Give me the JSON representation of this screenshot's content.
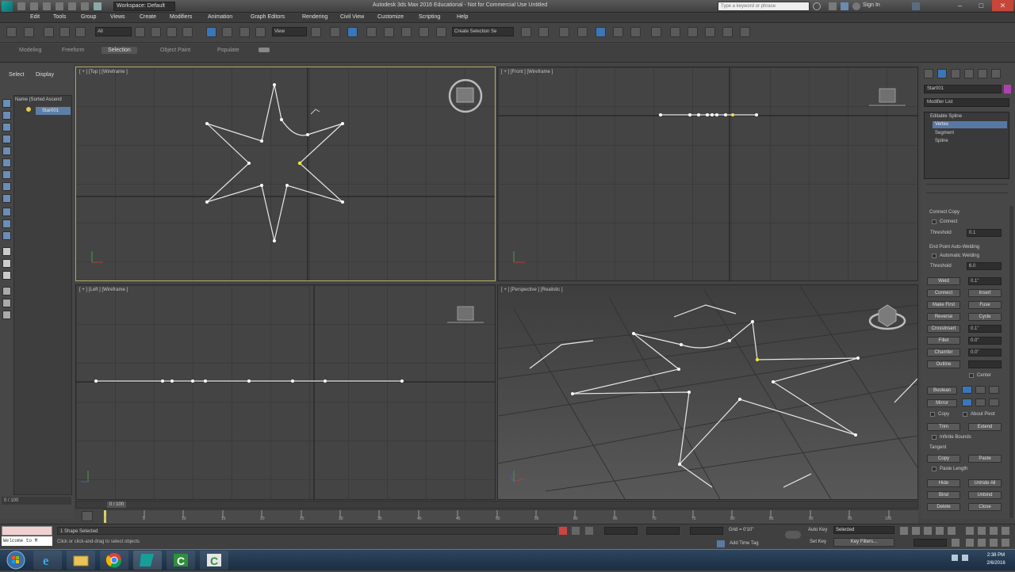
{
  "window": {
    "workspace": "Workspace: Default",
    "title": "Autodesk 3ds Max 2016 Educational - Not for Commercial Use   Untitled",
    "search_placeholder": "Type a keyword or phrase",
    "sign_in": "Sign In",
    "minimize": "–",
    "maximize": "□",
    "close": "✕"
  },
  "menus": [
    "Edit",
    "Tools",
    "Group",
    "Views",
    "Create",
    "Modifiers",
    "Animation",
    "Graph Editors",
    "Rendering",
    "Civil View",
    "Customize",
    "Scripting",
    "Help"
  ],
  "toolbar": {
    "selection_filter": "All",
    "ref_coord": "View",
    "named_selection": "Create Selection Se"
  },
  "ribbon_tabs": [
    "Modeling",
    "Freeform",
    "Selection",
    "Object Paint",
    "Populate"
  ],
  "ribbon_selected": "Selection",
  "scene_explorer": {
    "tab_select": "Select",
    "tab_display": "Display",
    "header": "Name (Sorted Ascend",
    "items": [
      "Star001"
    ],
    "footer": "0 / 100"
  },
  "viewports": {
    "top": "[ + ] [Top ] [Wireframe ]",
    "front": "[ + ] [Front ] [Wireframe ]",
    "left": "[ + ] [Left ] [Wireframe ]",
    "perspective": "[ + ] [Perspective ] [Realistic ]"
  },
  "command_panel": {
    "object_name": "Star001",
    "object_color": "#b23fb0",
    "modifier_list": "Modifier List",
    "stack": [
      "Editable Spline",
      "Vertex",
      "Segment",
      "Spline"
    ],
    "stack_selected": "Vertex",
    "connect_copy": "Connect Copy",
    "connect": "Connect",
    "threshold": "Threshold",
    "threshold_value": "0.1",
    "end_point_welding": "End Point Auto-Welding",
    "automatic_welding": "Automatic Welding",
    "threshold2_value": "6.0",
    "weld": "Weld",
    "weld_value": "0.1\"",
    "connect_btn": "Connect",
    "insert": "Insert",
    "make_first": "Make First",
    "fuse": "Fuse",
    "reverse": "Reverse",
    "cycle": "Cycle",
    "crossinsert": "CrossInsert",
    "crossinsert_value": "0.1\"",
    "fillet": "Fillet",
    "fillet_value": "0.0\"",
    "chamfer": "Chamfer",
    "chamfer_value": "0.0\"",
    "outline": "Outline",
    "center": "Center",
    "boolean": "Boolean",
    "mirror": "Mirror",
    "copy": "Copy",
    "about_pivot": "About Pivot",
    "trim": "Trim",
    "extend": "Extend",
    "infinite_bounds": "Infinite Bounds",
    "tangent": "Tangent",
    "copy2": "Copy",
    "paste": "Paste",
    "paste_length": "Paste Length",
    "hide": "Hide",
    "unhide_all": "Unhide All",
    "bind": "Bind",
    "unbind": "Unbind",
    "delete": "Delete",
    "close": "Close"
  },
  "timeline": {
    "frame": "0 / 100",
    "ticks": [
      "0",
      "5",
      "10",
      "15",
      "20",
      "25",
      "30",
      "35",
      "40",
      "45",
      "50",
      "55",
      "60",
      "65",
      "70",
      "75",
      "80",
      "85",
      "90",
      "95",
      "100"
    ]
  },
  "status": {
    "selection": "1 Shape Selected",
    "prompt": "Click or click-and-drag to select objects",
    "maxscript": "Welcome to M",
    "grid": "Grid = 0'10\"",
    "auto_key": "Auto Key",
    "selected": "Selected",
    "set_key": "Set Key",
    "key_filters": "Key Filters...",
    "add_time_tag": "Add Time Tag"
  },
  "taskbar": {
    "time": "2:38 PM",
    "date": "2/6/2016"
  }
}
